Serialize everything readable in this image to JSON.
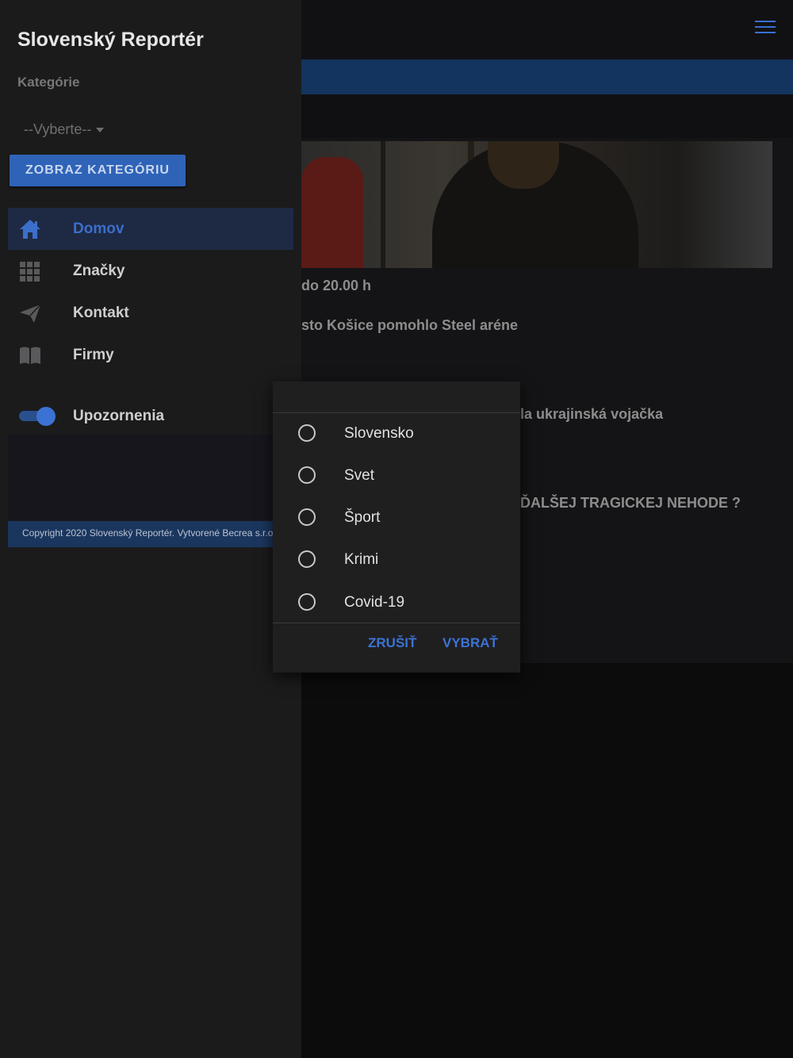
{
  "drawer": {
    "title": "Slovenský Reportér",
    "category_label": "Kategórie",
    "select_value": "--Vyberte--",
    "show_category_button": "ZOBRAZ KATEGÓRIU",
    "nav": [
      {
        "label": "Domov",
        "icon": "home-icon"
      },
      {
        "label": "Značky",
        "icon": "grid-icon"
      },
      {
        "label": "Kontakt",
        "icon": "send-icon"
      },
      {
        "label": "Firmy",
        "icon": "book-icon"
      }
    ],
    "notifications_label": "Upozornenia",
    "copyright": "Copyright 2020 Slovenský Reportér. Vytvorené Becrea s.r.o."
  },
  "background": {
    "headline_1": "do 20.00 h",
    "headline_2": "sto Košice pomohlo Steel aréne",
    "headline_3": "la ukrajinská vojačka",
    "headline_4": "ĎALŠEJ TRAGICKEJ NEHODE ?"
  },
  "dialog": {
    "options": [
      "Slovensko",
      "Svet",
      "Šport",
      "Krimi",
      "Covid-19"
    ],
    "cancel_label": "ZRUŠIŤ",
    "confirm_label": "VYBRAŤ"
  },
  "colors": {
    "accent": "#3b6fca",
    "drawer_bg": "#1b1b1c",
    "dialog_bg": "#1f1f20"
  }
}
